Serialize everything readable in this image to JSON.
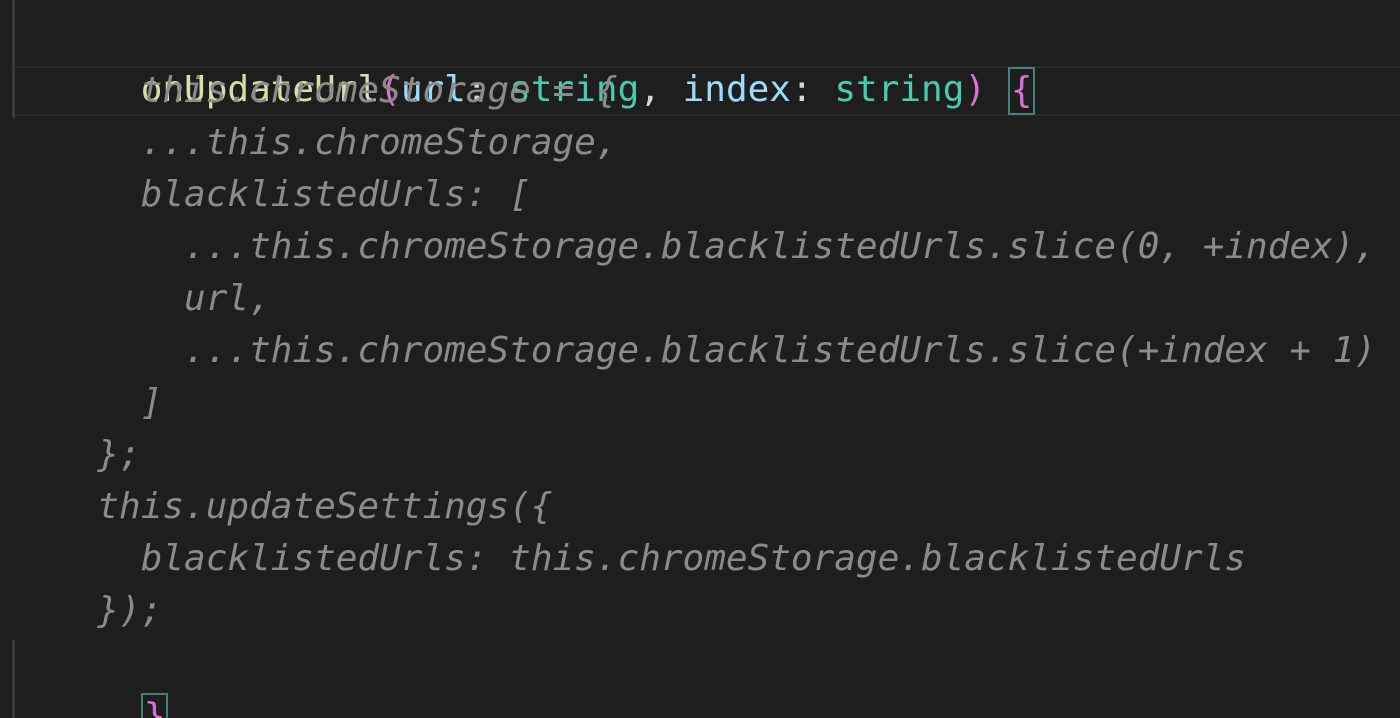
{
  "colors": {
    "background": "#1e1e1e",
    "method": "#dcdcaa",
    "paren": "#da70d6",
    "param": "#9cdcfe",
    "type": "#4ec9b0",
    "brace": "#da70d6",
    "punctuation": "#d4d4d4",
    "dimmed": "#8b8b8b"
  },
  "code": {
    "signature": {
      "method": "onUpdateUrl",
      "open_paren": "(",
      "param1": "url",
      "colon1": ": ",
      "type1": "string",
      "comma": ", ",
      "param2": "index",
      "colon2": ": ",
      "type2": "string",
      "close_paren": ")",
      "space": " ",
      "open_brace": "{"
    },
    "lines": [
      "    this.chromeStorage = {",
      "    ...this.chromeStorage,",
      "    blacklistedUrls: [",
      "      ...this.chromeStorage.blacklistedUrls.slice(0, +index),",
      "      url,",
      "      ...this.chromeStorage.blacklistedUrls.slice(+index + 1)",
      "    ]",
      "  };",
      "  this.updateSettings({",
      "    blacklistedUrls: this.chromeStorage.blacklistedUrls",
      "  });"
    ],
    "close_brace": "}"
  }
}
